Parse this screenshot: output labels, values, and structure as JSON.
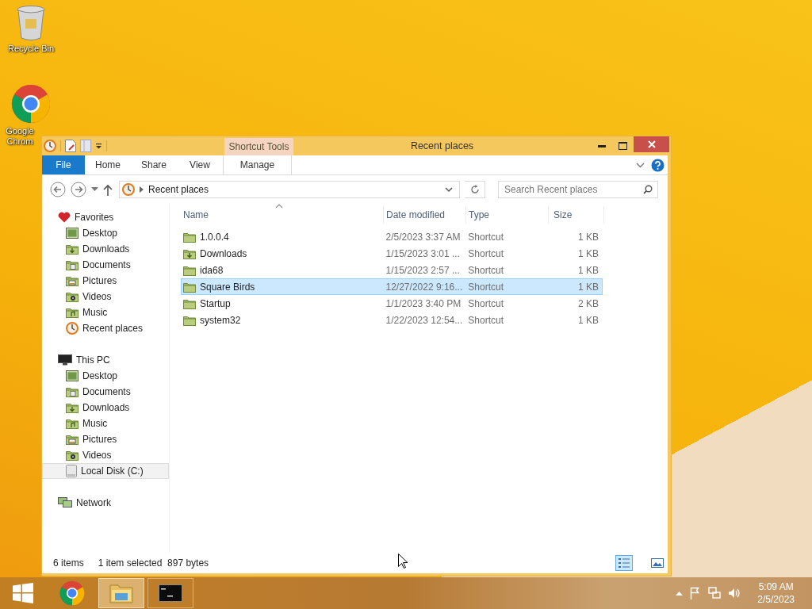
{
  "desktop": {
    "icons": [
      {
        "label": "Recycle Bin",
        "kind": "recycle-bin"
      },
      {
        "label": "Google Chrom",
        "kind": "chrome"
      }
    ]
  },
  "window": {
    "title": "Recent places",
    "context_group": "Shortcut Tools",
    "ribbon_tabs": [
      {
        "label": "File",
        "kind": "file"
      },
      {
        "label": "Home",
        "kind": "tab"
      },
      {
        "label": "Share",
        "kind": "tab"
      },
      {
        "label": "View",
        "kind": "tab"
      },
      {
        "label": "Manage",
        "kind": "context"
      }
    ],
    "address": {
      "path": "Recent places"
    },
    "search": {
      "placeholder": "Search Recent places"
    },
    "sidebar": {
      "groups": [
        {
          "label": "Favorites",
          "kind": "favorites",
          "children": [
            {
              "label": "Desktop",
              "kind": "desktop",
              "selected": false
            },
            {
              "label": "Downloads",
              "kind": "downloads",
              "selected": false
            },
            {
              "label": "Documents",
              "kind": "documents",
              "selected": false
            },
            {
              "label": "Pictures",
              "kind": "pictures",
              "selected": false
            },
            {
              "label": "Videos",
              "kind": "videos",
              "selected": false
            },
            {
              "label": "Music",
              "kind": "music",
              "selected": false
            },
            {
              "label": "Recent places",
              "kind": "recent",
              "selected": false
            }
          ]
        },
        {
          "label": "This PC",
          "kind": "pc",
          "children": [
            {
              "label": "Desktop",
              "kind": "desktop",
              "selected": false
            },
            {
              "label": "Documents",
              "kind": "documents",
              "selected": false
            },
            {
              "label": "Downloads",
              "kind": "downloads",
              "selected": false
            },
            {
              "label": "Music",
              "kind": "music",
              "selected": false
            },
            {
              "label": "Pictures",
              "kind": "pictures",
              "selected": false
            },
            {
              "label": "Videos",
              "kind": "videos",
              "selected": false
            },
            {
              "label": "Local Disk (C:)",
              "kind": "disk",
              "selected": true
            }
          ]
        },
        {
          "label": "Network",
          "kind": "network"
        }
      ]
    },
    "table": {
      "columns": [
        {
          "label": "Name",
          "sorted": true
        },
        {
          "label": "Date modified",
          "sorted": false
        },
        {
          "label": "Type",
          "sorted": false
        },
        {
          "label": "Size",
          "sorted": false
        }
      ],
      "rows": [
        {
          "name": "1.0.0.4",
          "date": "2/5/2023 3:37 AM",
          "type": "Shortcut",
          "size": "1 KB",
          "kind": "folder",
          "selected": false
        },
        {
          "name": "Downloads",
          "date": "1/15/2023 3:01 ...",
          "type": "Shortcut",
          "size": "1 KB",
          "kind": "downloads",
          "selected": false
        },
        {
          "name": "ida68",
          "date": "1/15/2023 2:57 ...",
          "type": "Shortcut",
          "size": "1 KB",
          "kind": "folder",
          "selected": false
        },
        {
          "name": "Square Birds",
          "date": "12/27/2022 9:16...",
          "type": "Shortcut",
          "size": "1 KB",
          "kind": "folder",
          "selected": true
        },
        {
          "name": "Startup",
          "date": "1/1/2023 3:40 PM",
          "type": "Shortcut",
          "size": "2 KB",
          "kind": "folder",
          "selected": false
        },
        {
          "name": "system32",
          "date": "1/22/2023 12:54...",
          "type": "Shortcut",
          "size": "1 KB",
          "kind": "folder",
          "selected": false
        }
      ]
    },
    "status_bar": {
      "count": "6 items",
      "selection": "1 item selected",
      "size": "897 bytes",
      "views": [
        {
          "kind": "details",
          "selected": true
        },
        {
          "kind": "large-icons",
          "selected": false
        }
      ]
    }
  },
  "taskbar": {
    "buttons": [
      {
        "kind": "start",
        "selected": false
      },
      {
        "kind": "chrome",
        "selected": false
      },
      {
        "kind": "explorer",
        "selected": true
      },
      {
        "kind": "cmd",
        "selected": false
      }
    ],
    "time": "5:09 AM",
    "date": "2/5/2023"
  }
}
